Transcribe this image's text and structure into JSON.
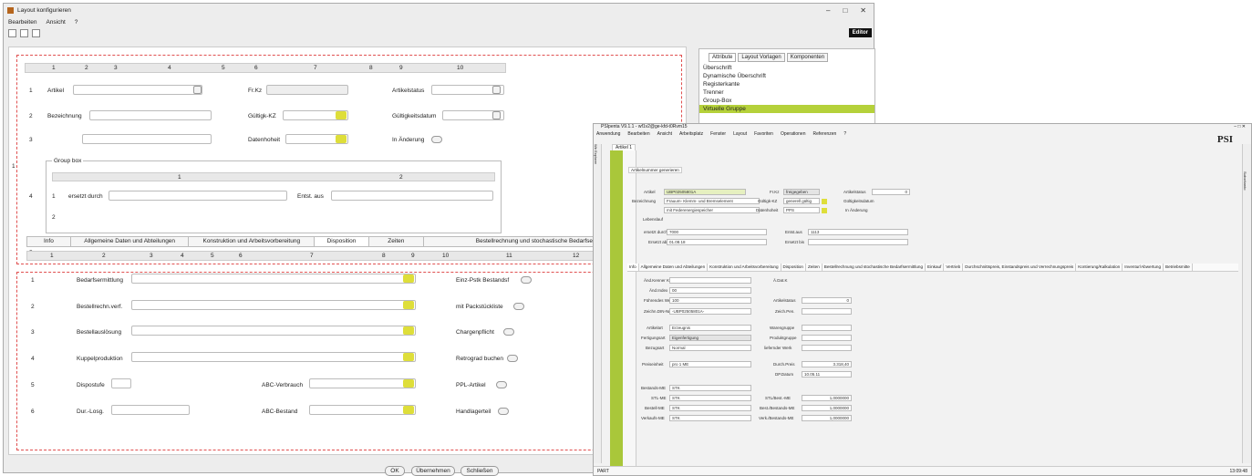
{
  "win1": {
    "title": "Layout konfigurieren",
    "menu": [
      "Bearbeiten",
      "Ansicht",
      "?"
    ],
    "editor": "Editor",
    "hdrTop": [
      "1",
      "2",
      "3",
      "4",
      "5",
      "6",
      "7",
      "8",
      "9",
      "10"
    ],
    "r1": {
      "rn": "1",
      "artikel": "Artikel",
      "frkz": "Fr.Kz",
      "artikelstatus": "Artikelstatus"
    },
    "r2": {
      "rn": "2",
      "bezeichnung": "Bezeichnung",
      "gueltigkz": "Gültigk-KZ",
      "gueltigkeitsdatum": "Gültigkeitsdatum"
    },
    "r3": {
      "rn": "3",
      "datenhoheit": "Datenhoheit",
      "inaenderung": "In Änderung"
    },
    "group": {
      "title": "Group box",
      "h1": "1",
      "h2": "2",
      "ersetzt": "ersetzt durch",
      "entst": "Entst. aus",
      "r1": "1",
      "r2": "2"
    },
    "rn4": "4",
    "rn5": "5",
    "tabs": [
      "Info",
      "Allgemeine Daten und Abteilungen",
      "Konstruktion und Arbeitsvorbereitung",
      "Disposition",
      "Zeiten",
      "Bestellrechnung und stochastische Bedarfsermittlung"
    ],
    "hdrBot": [
      "1",
      "2",
      "3",
      "4",
      "5",
      "6",
      "7",
      "8",
      "9",
      "10",
      "11",
      "12"
    ],
    "rows": [
      {
        "rn": "1",
        "l": "Bedarfsermittlung",
        "r": "Einz-Pstk Bestandsf"
      },
      {
        "rn": "2",
        "l": "Bestellrechn.verf.",
        "r": "mit Packstückliste"
      },
      {
        "rn": "3",
        "l": "Bestellauslösung",
        "r": "Chargenpflicht"
      },
      {
        "rn": "4",
        "l": "Kuppelproduktion",
        "r": "Retrograd buchen"
      },
      {
        "rn": "5",
        "l": "Dispostufe",
        "m": "ABC-Verbrauch",
        "r": "PPL-Artikel"
      },
      {
        "rn": "6",
        "l": "Dur.-Losg.",
        "m": "ABC-Bestand",
        "r": "Handlagerteil"
      }
    ],
    "side": {
      "tabs": [
        "Attribute",
        "Layout Vorlagen",
        "Komponenten"
      ],
      "items": [
        "Überschrift",
        "Dynamische Überschrift",
        "Registerkante",
        "Trenner",
        "Group-Box",
        "Virtuelle Gruppe"
      ]
    },
    "buttons": {
      "ok": "OK",
      "apply": "Übernehmen",
      "close": "Schließen"
    }
  },
  "win2": {
    "title": "PSIpenta V9.1.1 - wf1v2@ge-kfd-t0Rvm15",
    "menu": [
      "Anwendung",
      "Bearbeiten",
      "Ansicht",
      "Arbeitsplatz",
      "Fenster",
      "Layout",
      "Favoriten",
      "Operationen",
      "Referenzen",
      "?"
    ],
    "logo": "PSI",
    "tab": "Artikel 1",
    "gen": "Artikelnummer generieren",
    "artikel": "Artikel",
    "artikelVal": "UBP02505801A",
    "bez": "Bezeichnung",
    "bezVal": "Frauum- Klemm- und Bremselement",
    "bez2": "mit Federenergiespeicher",
    "frkz": "Fr.Kz",
    "frkzVal": "freigegeben",
    "gkz": "Gültigk-KZ",
    "gkzVal": "generell gültig",
    "dh": "Datenhoheit",
    "dhVal": "PPS",
    "as": "Artikelstatus",
    "asVal": "0",
    "gd": "Gültigkeitsdatum",
    "ia": "In Änderung",
    "leb": "Lebenslauf",
    "ed": "ersetzt durch",
    "edVal": "7000",
    "ea": "Entst.aus",
    "eaVal": "1113",
    "eab": "Ersetzt ab",
    "eabVal": "01.08.18",
    "eb": "Ersetzt bis",
    "tabs": [
      "Info",
      "Allgemeine Daten und Abteilungen",
      "Konstruktion und Arbeitsvorbereitung",
      "Disposition",
      "Zeiten",
      "Bestellrechnung und stochastische Bedarfsermittlung",
      "Einkauf",
      "Vertrieb",
      "Durchschnittspreis, Einstandspreis und Verrechnungspreis",
      "Kontierung/Kalkulation",
      "Inventur/Abwertung",
      "Betriebsmitte"
    ],
    "f": [
      [
        "Änd.Kenner Kon",
        ""
      ],
      [
        "Änd.Index",
        "00"
      ],
      [
        "Führendes Werk",
        "100"
      ],
      [
        "Zeichn.DIN-Nr",
        "-UBP02505801A-"
      ],
      [
        "Artikelart",
        "Erzeugnis"
      ],
      [
        "Fertigungsart",
        "Eigenfertigung"
      ],
      [
        "Bezugsart",
        "Normal"
      ],
      [
        "Preiseinheit",
        "pro 1 ME"
      ],
      [
        "Bestands-ME",
        "STK"
      ],
      [
        "STL-ME",
        "STK"
      ],
      [
        "Bestell-ME",
        "STK"
      ],
      [
        "Verkaufs-ME",
        "STK"
      ]
    ],
    "g": [
      [
        "Ä.Dat.K",
        ""
      ],
      [
        "Artikelstatus",
        "0"
      ],
      [
        "Zeich.Pen.",
        ""
      ],
      [
        "Warengruppe",
        ""
      ],
      [
        "Produktgruppe",
        ""
      ],
      [
        "liefernder Werk",
        ""
      ],
      [
        "Durch.Preis",
        "3.318,40"
      ],
      [
        "DP.Datum",
        "10.05.11"
      ],
      [
        "STL/Best.-ME",
        "1,0000000"
      ],
      [
        "Best./Bestands-ME",
        "1,0000000"
      ],
      [
        "Verk./Bestands-ME",
        "1,0000000"
      ]
    ],
    "status": "PART",
    "clock": "13:09:48",
    "sideR": "Suborkanto",
    "sideL": "Wir Explorer"
  }
}
